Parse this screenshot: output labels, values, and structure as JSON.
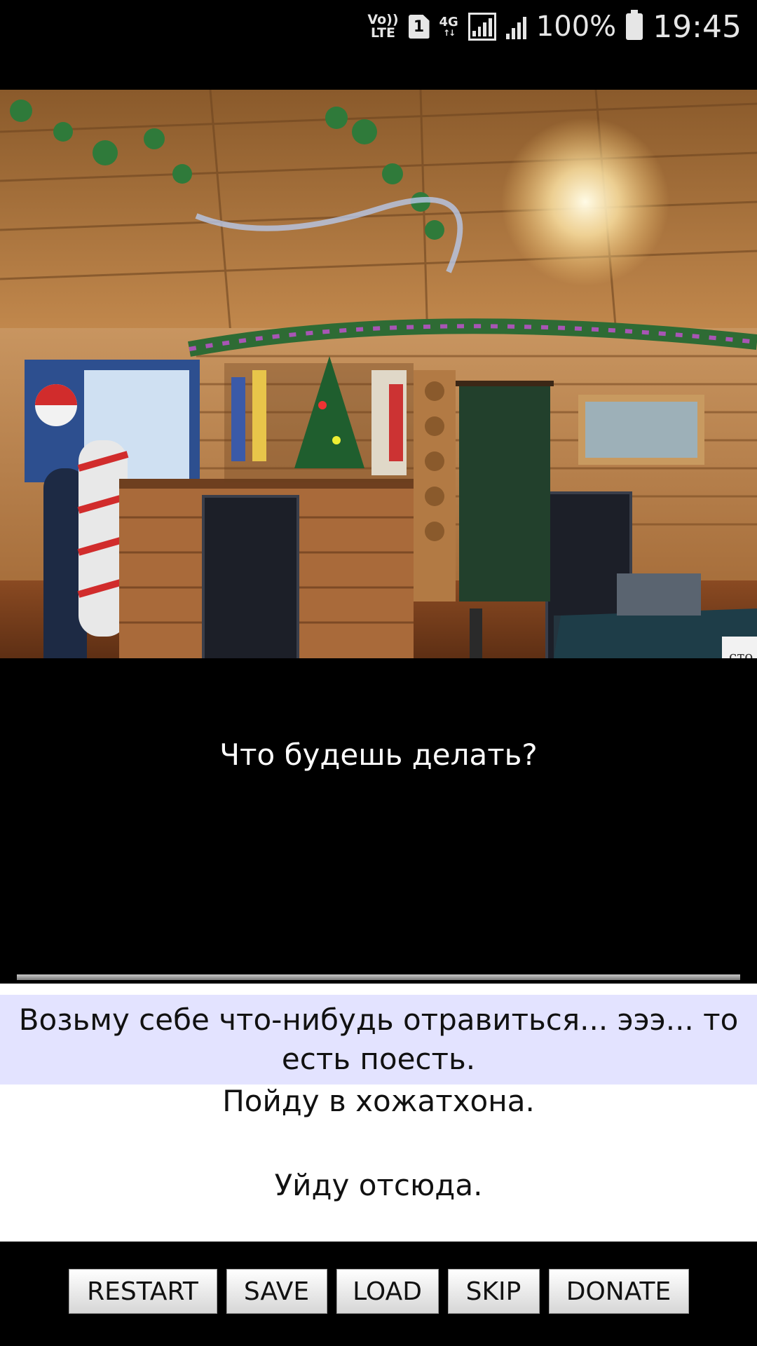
{
  "status_bar": {
    "volte_top": "Vo))",
    "volte_bottom": "LTE",
    "sim_slot": "1",
    "network": "4G",
    "network_arrows": "↑↓",
    "battery_percent": "100%",
    "time": "19:45"
  },
  "scene": {
    "image_subject": "cafe interior with bar counter, speakers, christmas tree, tables",
    "sign_text": "сто"
  },
  "narration": {
    "text": "Что будешь делать?"
  },
  "choices": [
    {
      "label": "Возьму себе что-нибудь отравиться... эээ... то есть поесть.",
      "selected": true
    },
    {
      "label": "Пойду в хожатхона.",
      "selected": false
    },
    {
      "label": "Уйду отсюда.",
      "selected": false
    }
  ],
  "buttons": {
    "restart": "RESTART",
    "save": "SAVE",
    "load": "LOAD",
    "skip": "SKIP",
    "donate": "DONATE"
  },
  "colors": {
    "background": "#000000",
    "selected_choice": "#e3e3ff",
    "choices_panel": "#ffffff"
  }
}
